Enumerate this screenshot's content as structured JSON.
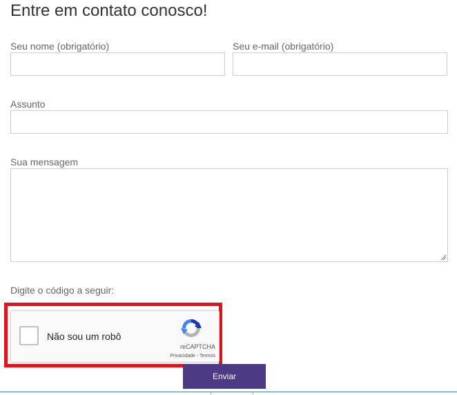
{
  "form": {
    "title": "Entre em contato conosco!",
    "name_label": "Seu nome (obrigatório)",
    "name_value": "",
    "email_label": "Seu e-mail (obrigatório)",
    "email_value": "",
    "subject_label": "Assunto",
    "subject_value": "",
    "message_label": "Sua mensagem",
    "message_value": "",
    "code_label": "Digite o código a seguir:",
    "submit_label": "Enviar"
  },
  "captcha": {
    "checkbox_label": "Não sou um robô",
    "brand": "reCAPTCHA",
    "links": "Privacidade - Termos",
    "checked": false
  },
  "colors": {
    "submit_bg": "#4d3a85",
    "highlight": "#e0141e",
    "captcha_blue": "#1c3aa9",
    "captcha_lightblue": "#4285f4",
    "captcha_gray": "#b4b4b4"
  },
  "icons": {
    "captcha_logo": "recaptcha-logo-icon",
    "textarea_grip": "resize-grip-icon"
  }
}
